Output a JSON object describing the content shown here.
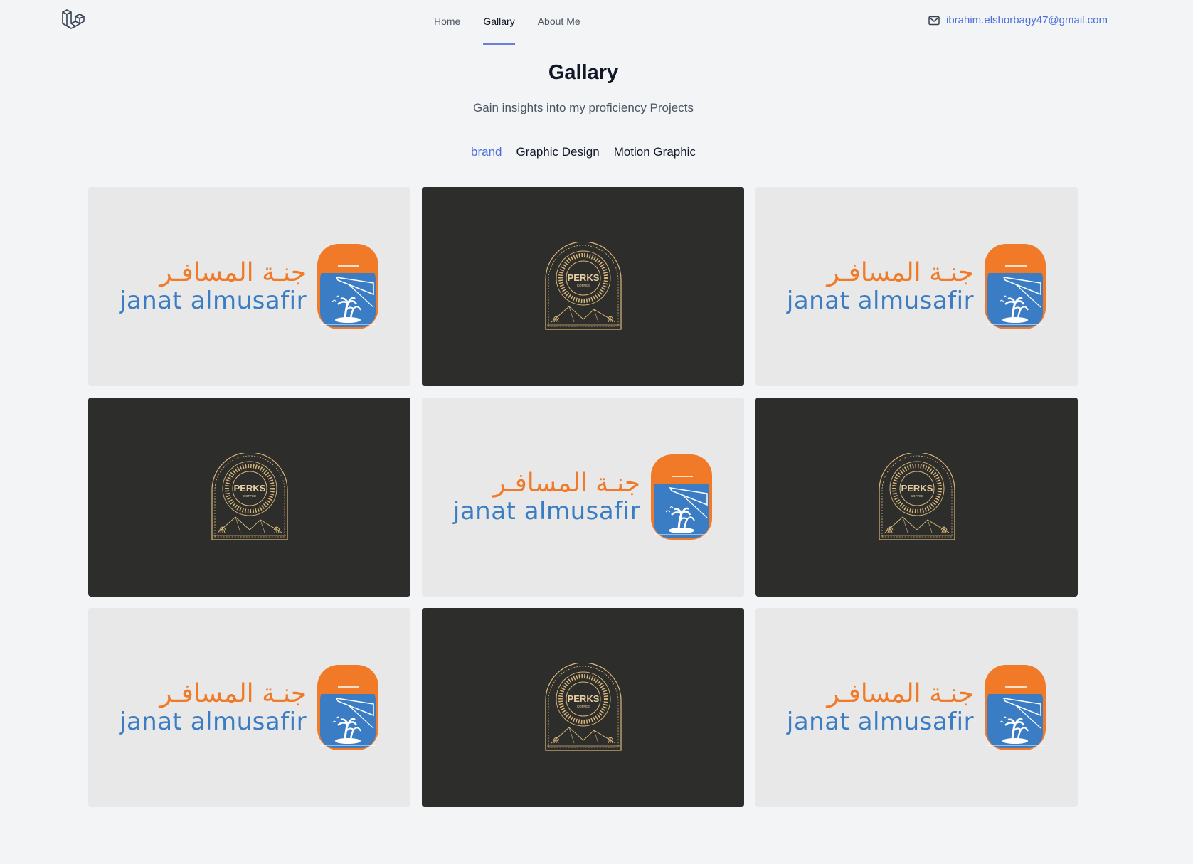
{
  "nav": {
    "items": [
      {
        "label": "Home",
        "active": false
      },
      {
        "label": "Gallary",
        "active": true
      },
      {
        "label": "About Me",
        "active": false
      }
    ]
  },
  "contact": {
    "icon": "mail-icon",
    "email": "ibrahim.elshorbagy47@gmail.com"
  },
  "header": {
    "title": "Gallary",
    "subtitle": "Gain insights into my proficiency Projects"
  },
  "filters": [
    {
      "label": "brand",
      "active": true
    },
    {
      "label": "Graphic Design",
      "active": false
    },
    {
      "label": "Motion Graphic",
      "active": false
    }
  ],
  "brands": {
    "janat": {
      "arabic": "جنـة المسافـر",
      "latin": "janat almusafir"
    },
    "perks": {
      "name": "PERKS",
      "tagline": "COFFEE"
    }
  },
  "gallery": [
    {
      "logo": "janat",
      "theme": "light"
    },
    {
      "logo": "perks",
      "theme": "dark"
    },
    {
      "logo": "janat",
      "theme": "light"
    },
    {
      "logo": "perks",
      "theme": "dark"
    },
    {
      "logo": "janat",
      "theme": "light"
    },
    {
      "logo": "perks",
      "theme": "dark"
    },
    {
      "logo": "janat",
      "theme": "light"
    },
    {
      "logo": "perks",
      "theme": "dark"
    },
    {
      "logo": "janat",
      "theme": "light"
    }
  ],
  "colors": {
    "accent": "#4a6fdc",
    "janat_orange": "#f07a27",
    "janat_blue": "#3b7dc4",
    "perks_gold": "#d9b77a",
    "dark_card": "#2d2d2b",
    "light_card": "#e8e8e8"
  }
}
